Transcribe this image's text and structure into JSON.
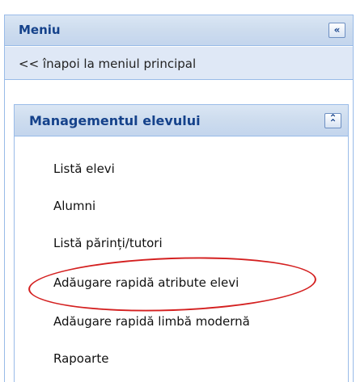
{
  "menu": {
    "title": "Meniu",
    "collapse_glyph": "«",
    "collapse_icon": "double-chevron-left-icon",
    "back_link": "<< înapoi la meniul principal"
  },
  "section": {
    "title": "Managementul elevului",
    "collapse_glyph": "⌃",
    "collapse_icon": "double-chevron-up-icon",
    "items": [
      {
        "label": "Listă elevi"
      },
      {
        "label": "Alumni"
      },
      {
        "label": "Listă părinți/tutori"
      },
      {
        "label": "Adăugare rapidă atribute elevi",
        "highlighted": true
      },
      {
        "label": "Adăugare rapidă limbă modernă"
      },
      {
        "label": "Rapoarte"
      }
    ]
  },
  "colors": {
    "header_text": "#15428b",
    "panel_border": "#99bbe8",
    "back_row_bg": "#dfe8f6",
    "highlight_ring": "#d42020"
  }
}
